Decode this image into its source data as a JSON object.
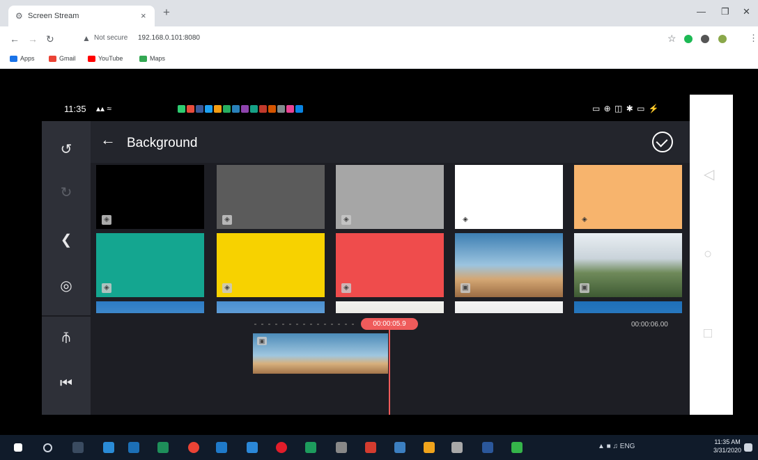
{
  "browser": {
    "tab_title": "Screen Stream",
    "tab_close": "×",
    "new_tab": "+",
    "security": "Not secure",
    "url": "192.168.0.101:8080",
    "bookmarks": [
      "Apps",
      "Gmail",
      "YouTube",
      "Maps"
    ]
  },
  "phone_status": {
    "time": "11:35",
    "system_icons": "▭ ⊕ ◫ ✱ ▭ ⚡"
  },
  "editor": {
    "title": "Background",
    "back_icon": "←",
    "tiles": [
      {
        "color": "#000000"
      },
      {
        "color": "#5b5b5b"
      },
      {
        "color": "#a6a6a6"
      },
      {
        "color": "#ffffff"
      },
      {
        "color": "#f7b46d"
      },
      {
        "color": "#14a690"
      },
      {
        "color": "#f7d200"
      },
      {
        "color": "#ef4c4c"
      },
      {
        "color": "photo-ruins"
      },
      {
        "color": "photo-castle"
      }
    ],
    "timeline": {
      "playhead_time": "00:00:05.9",
      "duration": "00:00:06.00"
    }
  },
  "colors": {
    "accent": "#ef5b5b",
    "panel": "#1d1e24",
    "sidebar": "#2e3038"
  },
  "taskbar": {
    "clock_time": "11:35 AM",
    "clock_date": "3/31/2020",
    "lang": "ENG"
  }
}
